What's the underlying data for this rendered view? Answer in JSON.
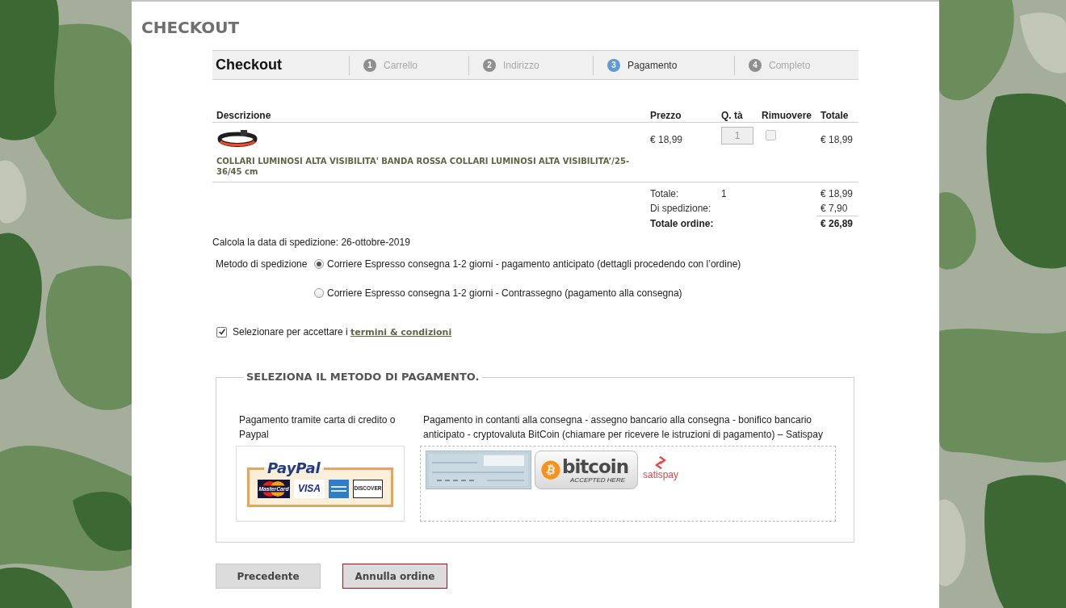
{
  "page": {
    "title": "CHECKOUT"
  },
  "steps_bar": {
    "title": "Checkout",
    "steps": [
      {
        "number": "1",
        "label": "Carrello",
        "selected": false
      },
      {
        "number": "2",
        "label": "Indirizzo",
        "selected": false
      },
      {
        "number": "3",
        "label": "Pagamento",
        "selected": true
      },
      {
        "number": "4",
        "label": "Completo",
        "selected": false
      }
    ]
  },
  "cart_table": {
    "columns": [
      "Descrizione",
      "Prezzo",
      "Q. tà",
      "Rimuovere",
      "Totale"
    ],
    "rows": [
      {
        "description": "COLLARI LUMINOSI ALTA VISIBILITA' BANDA ROSSA COLLARI LUMINOSI ALTA VISIBILITA’/25-36/45 cm",
        "price": "€ 18,99",
        "quantity": "1",
        "remove": false,
        "total": "€ 18,99"
      }
    ]
  },
  "totals": [
    {
      "label": "Totale:",
      "quantity": "1",
      "value": "€ 18,99",
      "kind": "subtotal"
    },
    {
      "label": "Di spedizione:",
      "value": "€ 7,90",
      "kind": "subtotal"
    },
    {
      "label": "Totale ordine:",
      "value": "€ 26,89",
      "kind": "grand"
    }
  ],
  "shipping_date": "Calcola la data di spedizione: 26-ottobre-2019",
  "shipping_method": {
    "label": "Metodo di spedizione",
    "options": [
      {
        "label": "Corriere Espresso consegna 1-2 giorni - pagamento anticipato (dettagli procedendo con l’ordine)",
        "selected": true
      },
      {
        "label": "Corriere Espresso consegna 1-2 giorni - Contrassegno (pagamento alla consegna)",
        "selected": false
      }
    ]
  },
  "terms": {
    "checked": true,
    "text": "Selezionare per accettare i",
    "link": "termini & condizioni"
  },
  "payment": {
    "legend": "SELEZIONA IL METODO DI PAGAMENTO.",
    "methods": [
      {
        "kind": "cards",
        "description": "Pagamento tramite carta di credito o Paypal",
        "logos": [
          {
            "kind": "paypal",
            "wordmark": "PayPal",
            "cards": [
              {
                "kind": "mastercard",
                "label": "MasterCard"
              },
              {
                "kind": "visa",
                "label": "VISA"
              },
              {
                "kind": "amex"
              },
              {
                "kind": "discover",
                "label": "DISCOVER"
              }
            ]
          }
        ]
      },
      {
        "kind": "offline",
        "description": "Pagamento in contanti alla consegna - assegno bancario alla consegna - bonifico bancario anticipato - cryptovaluta BitCoin (chiamare per ricevere le istruzioni di pagamento) – Satispay",
        "logos": [
          {
            "kind": "cheque"
          },
          {
            "kind": "bitcoin",
            "wordmark": "bitcoin",
            "tagline": "ACCEPTED HERE"
          },
          {
            "kind": "satispay",
            "wordmark": "satispay"
          }
        ]
      }
    ]
  },
  "buttons": [
    {
      "label": "Precedente",
      "kind": "secondary"
    },
    {
      "label": "Annulla ordine",
      "kind": "cancel"
    }
  ]
}
